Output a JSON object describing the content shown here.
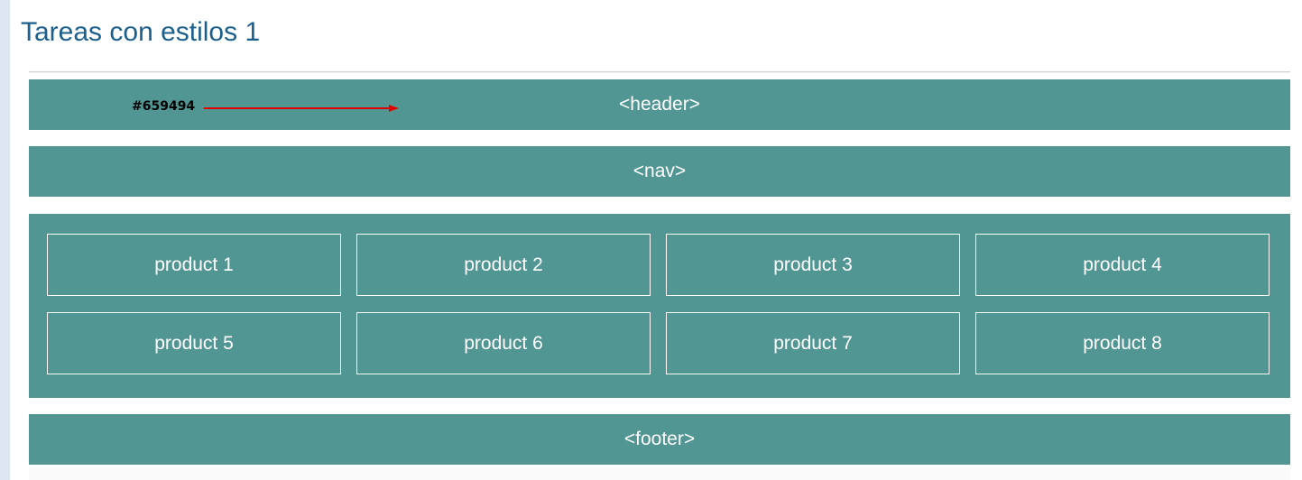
{
  "page": {
    "title": "Tareas con estilos 1"
  },
  "annotation": {
    "color_label": "#659494",
    "arrow_color": "#e00000"
  },
  "layout_boxes": {
    "header_label": "<header>",
    "nav_label": "<nav>",
    "footer_label": "<footer>",
    "box_color": "#659494",
    "rendered_color": "#519693"
  },
  "products": [
    {
      "label": "product 1"
    },
    {
      "label": "product 2"
    },
    {
      "label": "product 3"
    },
    {
      "label": "product 4"
    },
    {
      "label": "product 5"
    },
    {
      "label": "product 6"
    },
    {
      "label": "product 7"
    },
    {
      "label": "product 8"
    }
  ],
  "colors": {
    "title": "#1b5f8c",
    "panel": "#519693",
    "text_on_panel": "#ffffff"
  }
}
